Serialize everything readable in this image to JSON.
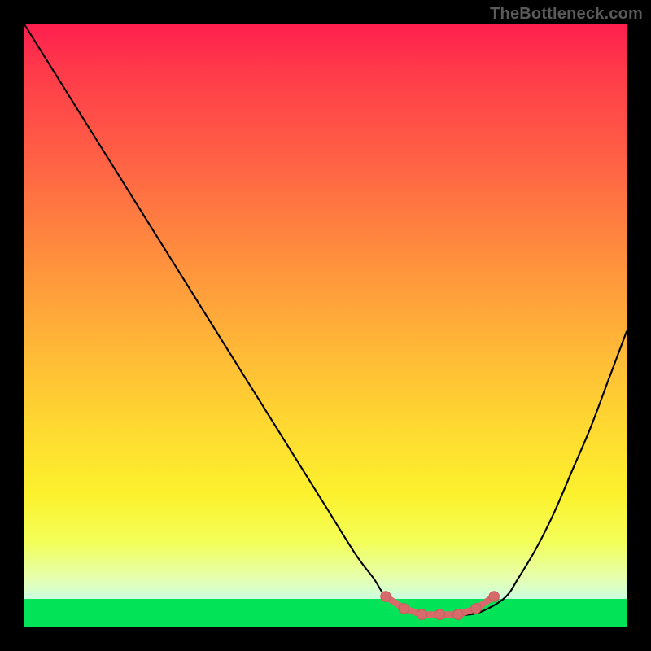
{
  "watermark": "TheBottleneck.com",
  "colors": {
    "frame_bg": "#000000",
    "gradient_top": "#ff1f4f",
    "gradient_orange": "#ff8d3e",
    "gradient_yellow": "#fcf12d",
    "gradient_pale": "#ccffe0",
    "gradient_green": "#02e357",
    "curve_stroke": "#000000",
    "marker_fill": "#d76a6a",
    "marker_stroke": "#c95a5a",
    "watermark_color": "#5a5a5a"
  },
  "chart_data": {
    "type": "line",
    "title": "",
    "xlabel": "",
    "ylabel": "",
    "xlim": [
      0,
      100
    ],
    "ylim": [
      0,
      100
    ],
    "grid": false,
    "legend": false,
    "series": [
      {
        "name": "bottleneck-curve",
        "x": [
          0,
          5,
          10,
          15,
          20,
          25,
          30,
          35,
          40,
          45,
          50,
          55,
          58,
          60,
          63,
          66,
          70,
          74,
          77,
          80,
          82,
          85,
          88,
          91,
          94,
          97,
          100
        ],
        "y": [
          100,
          92,
          84,
          76,
          68,
          60,
          52,
          44,
          36,
          28,
          20,
          12,
          8,
          5,
          3,
          2,
          2,
          2,
          3,
          5,
          8,
          13,
          19,
          26,
          33,
          41,
          49
        ]
      },
      {
        "name": "optimal-range-markers",
        "x": [
          60,
          63,
          66,
          69,
          72,
          75,
          78
        ],
        "y": [
          5,
          3,
          2,
          2,
          2,
          3,
          5
        ]
      }
    ],
    "annotations": [],
    "green_band_y_range": [
      0,
      4.6
    ]
  }
}
